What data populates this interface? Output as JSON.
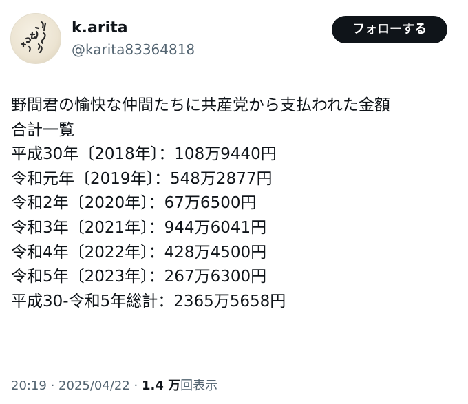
{
  "author": {
    "display_name": "k.arita",
    "handle": "@karita83364818",
    "avatar_icon": "handwritten-calligraphy-avatar"
  },
  "follow_button": {
    "label": "フォローする"
  },
  "tweet": {
    "lines": [
      "野間君の愉快な仲間たちに共産党から支払われた金額",
      "合計一覧",
      "平成30年〔2018年〕：108万9440円",
      "令和元年〔2019年〕：548万2877円",
      "令和2年〔2020年〕：67万6500円",
      "令和3年〔2021年〕：944万6041円",
      "令和4年〔2022年〕：428万4500円",
      "令和5年〔2023年〕：267万6300円",
      "平成30-令和5年総計：2365万5658円"
    ]
  },
  "meta": {
    "time": "20:19",
    "separator": " · ",
    "date": "2025/04/22",
    "separator2": " · ",
    "views_count": "1.4 万",
    "views_label": "回表示"
  },
  "colors": {
    "text_primary": "#0f1419",
    "text_secondary": "#536471",
    "follow_bg": "#0f1419",
    "follow_text": "#ffffff",
    "background": "#ffffff"
  }
}
